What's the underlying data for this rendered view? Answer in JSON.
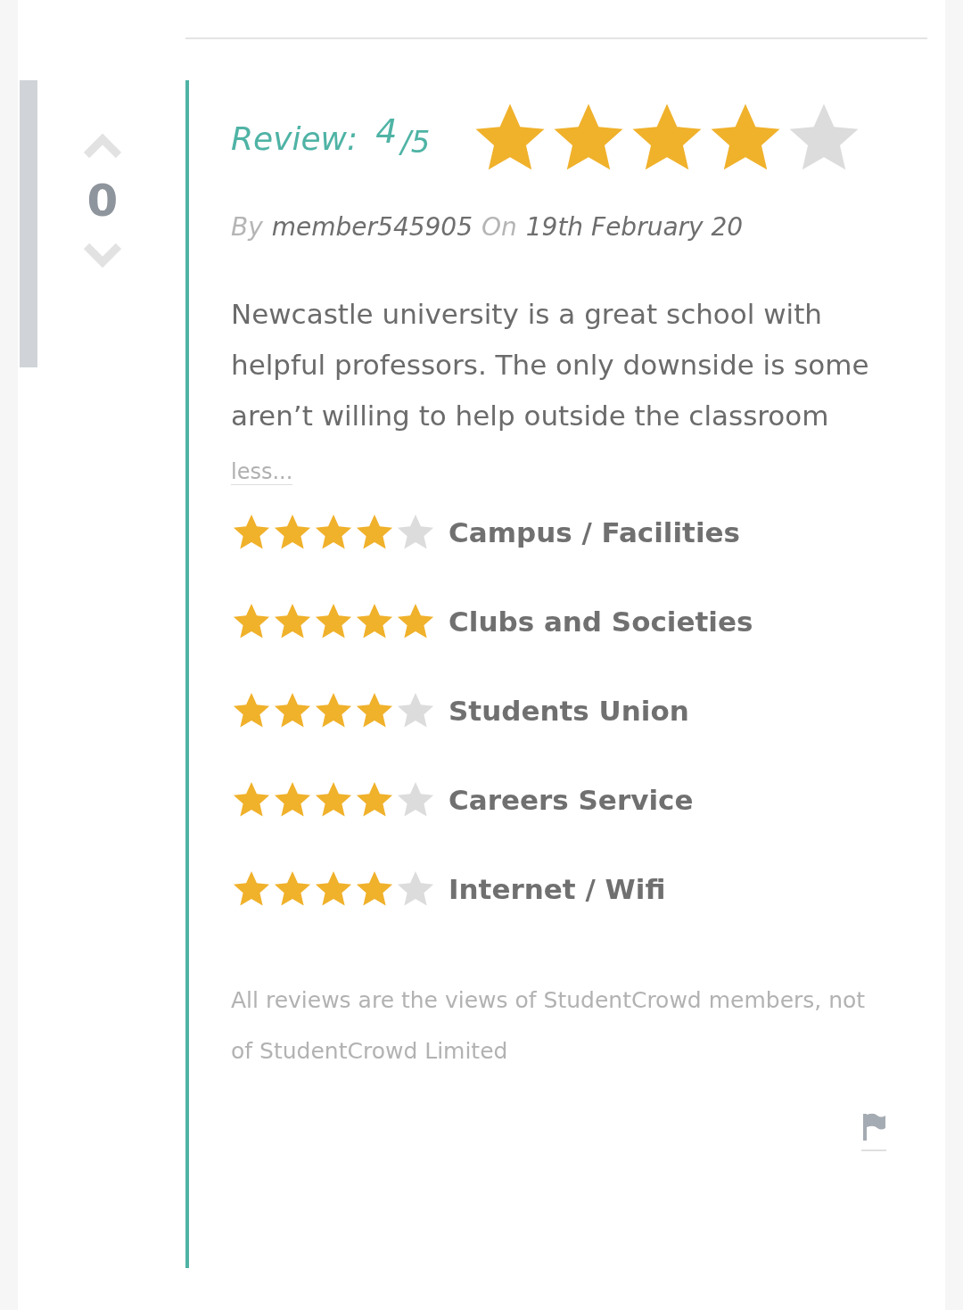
{
  "vote": {
    "score": "0"
  },
  "review": {
    "label": "Review:",
    "score": "4",
    "out_of": "/5",
    "stars": 4
  },
  "byline": {
    "by": "By",
    "author": "member545905",
    "on": "On",
    "date": "19th February 20"
  },
  "body": "Newcastle university is a great school with helpful professors. The only downside is some aren’t willing to help outside the classroom",
  "less_link": "less...",
  "ratings": [
    {
      "label": "Campus / Facilities",
      "stars": 4
    },
    {
      "label": "Clubs and Societies",
      "stars": 5
    },
    {
      "label": "Students Union",
      "stars": 4
    },
    {
      "label": "Careers Service",
      "stars": 4
    },
    {
      "label": "Internet / Wifi",
      "stars": 4
    }
  ],
  "disclaimer": "All reviews are the views of StudentCrowd members, not of StudentCrowd Limited"
}
